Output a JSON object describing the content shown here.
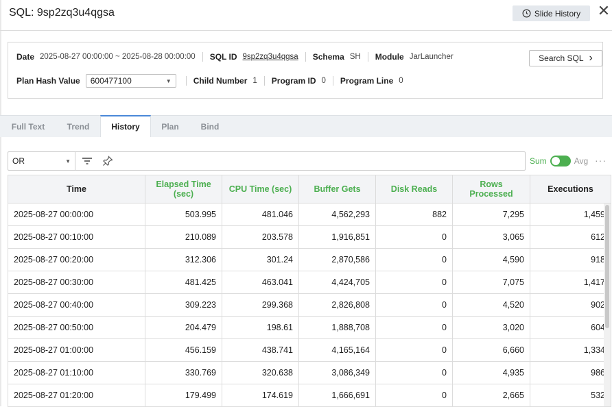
{
  "header": {
    "title": "SQL: 9sp2zq3u4qgsa",
    "slide_history_label": "Slide History",
    "close_glyph": "✕"
  },
  "info": {
    "date_label": "Date",
    "date_value": "2025-08-27 00:00:00 ~ 2025-08-28 00:00:00",
    "sqlid_label": "SQL ID",
    "sqlid_value": "9sp2zq3u4qgsa",
    "schema_label": "Schema",
    "schema_value": "SH",
    "module_label": "Module",
    "module_value": "JarLauncher",
    "plan_hash_label": "Plan Hash Value",
    "plan_hash_value": "600477100",
    "child_label": "Child Number",
    "child_value": "1",
    "program_id_label": "Program ID",
    "program_id_value": "0",
    "program_line_label": "Program Line",
    "program_line_value": "0",
    "search_sql_label": "Search SQL",
    "search_chevron": "›"
  },
  "tabs": [
    {
      "label": "Full Text"
    },
    {
      "label": "Trend"
    },
    {
      "label": "History"
    },
    {
      "label": "Plan"
    },
    {
      "label": "Bind"
    }
  ],
  "active_tab": "History",
  "toolbar": {
    "operator_value": "OR",
    "sum_label": "Sum",
    "avg_label": "Avg",
    "more_glyph": "···",
    "toggle_state": "Sum"
  },
  "colors": {
    "accent_green": "#4caf50",
    "tab_active_border": "#4a88d8"
  },
  "table": {
    "headers": [
      "Time",
      "Elapsed Time (sec)",
      "CPU Time (sec)",
      "Buffer Gets",
      "Disk Reads",
      "Rows Processed",
      "Executions"
    ],
    "rows": [
      [
        "2025-08-27 00:00:00",
        "503.995",
        "481.046",
        "4,562,293",
        "882",
        "7,295",
        "1,459"
      ],
      [
        "2025-08-27 00:10:00",
        "210.089",
        "203.578",
        "1,916,851",
        "0",
        "3,065",
        "612"
      ],
      [
        "2025-08-27 00:20:00",
        "312.306",
        "301.24",
        "2,870,586",
        "0",
        "4,590",
        "918"
      ],
      [
        "2025-08-27 00:30:00",
        "481.425",
        "463.041",
        "4,424,705",
        "0",
        "7,075",
        "1,417"
      ],
      [
        "2025-08-27 00:40:00",
        "309.223",
        "299.368",
        "2,826,808",
        "0",
        "4,520",
        "902"
      ],
      [
        "2025-08-27 00:50:00",
        "204.479",
        "198.61",
        "1,888,708",
        "0",
        "3,020",
        "604"
      ],
      [
        "2025-08-27 01:00:00",
        "456.159",
        "438.741",
        "4,165,164",
        "0",
        "6,660",
        "1,334"
      ],
      [
        "2025-08-27 01:10:00",
        "330.769",
        "320.638",
        "3,086,349",
        "0",
        "4,935",
        "986"
      ],
      [
        "2025-08-27 01:20:00",
        "179.499",
        "174.619",
        "1,666,691",
        "0",
        "2,665",
        "532"
      ]
    ]
  }
}
